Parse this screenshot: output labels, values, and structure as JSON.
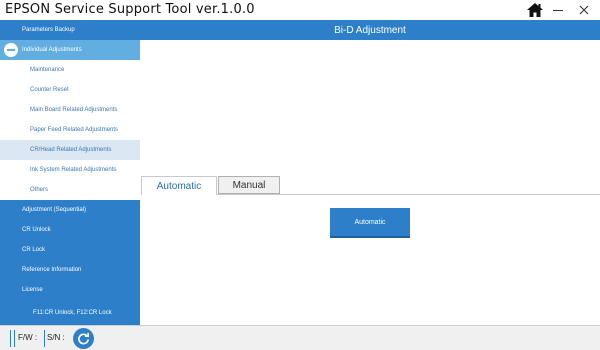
{
  "app": {
    "title": "EPSON Service Support Tool  ver.1.0.0"
  },
  "window": {
    "home_icon": "home-icon",
    "minimize_icon": "minimize-icon",
    "close_icon": "close-icon"
  },
  "sidebar": {
    "top_item": "Parameters Backup",
    "expanded_item": "Individual Adjustments",
    "sub_items": [
      "Maintenance",
      "Counter Reset",
      "Main Board Related Adjustments",
      "Paper Feed Related Adjustments",
      "CR/Head Related Adjustments",
      "Ink System Related Adjustments",
      "Others"
    ],
    "bottom_items": [
      "Adjustment (Sequential)",
      "CR Unlock",
      "CR Lock",
      "Reference Information",
      "License"
    ],
    "shortcut_hint": "F11:CR Unlock, F12:CR Lock"
  },
  "main": {
    "header": "Bi-D Adjustment",
    "tabs": [
      "Automatic",
      "Manual"
    ],
    "active_tab": "Automatic",
    "automatic_button": "Automatic"
  },
  "statusbar": {
    "fw_label": "F/W :",
    "sn_label": "S/N :"
  },
  "colors": {
    "accent": "#2e7fc9",
    "accent_light": "#62aee0",
    "selected_row": "#dbe7f2"
  }
}
